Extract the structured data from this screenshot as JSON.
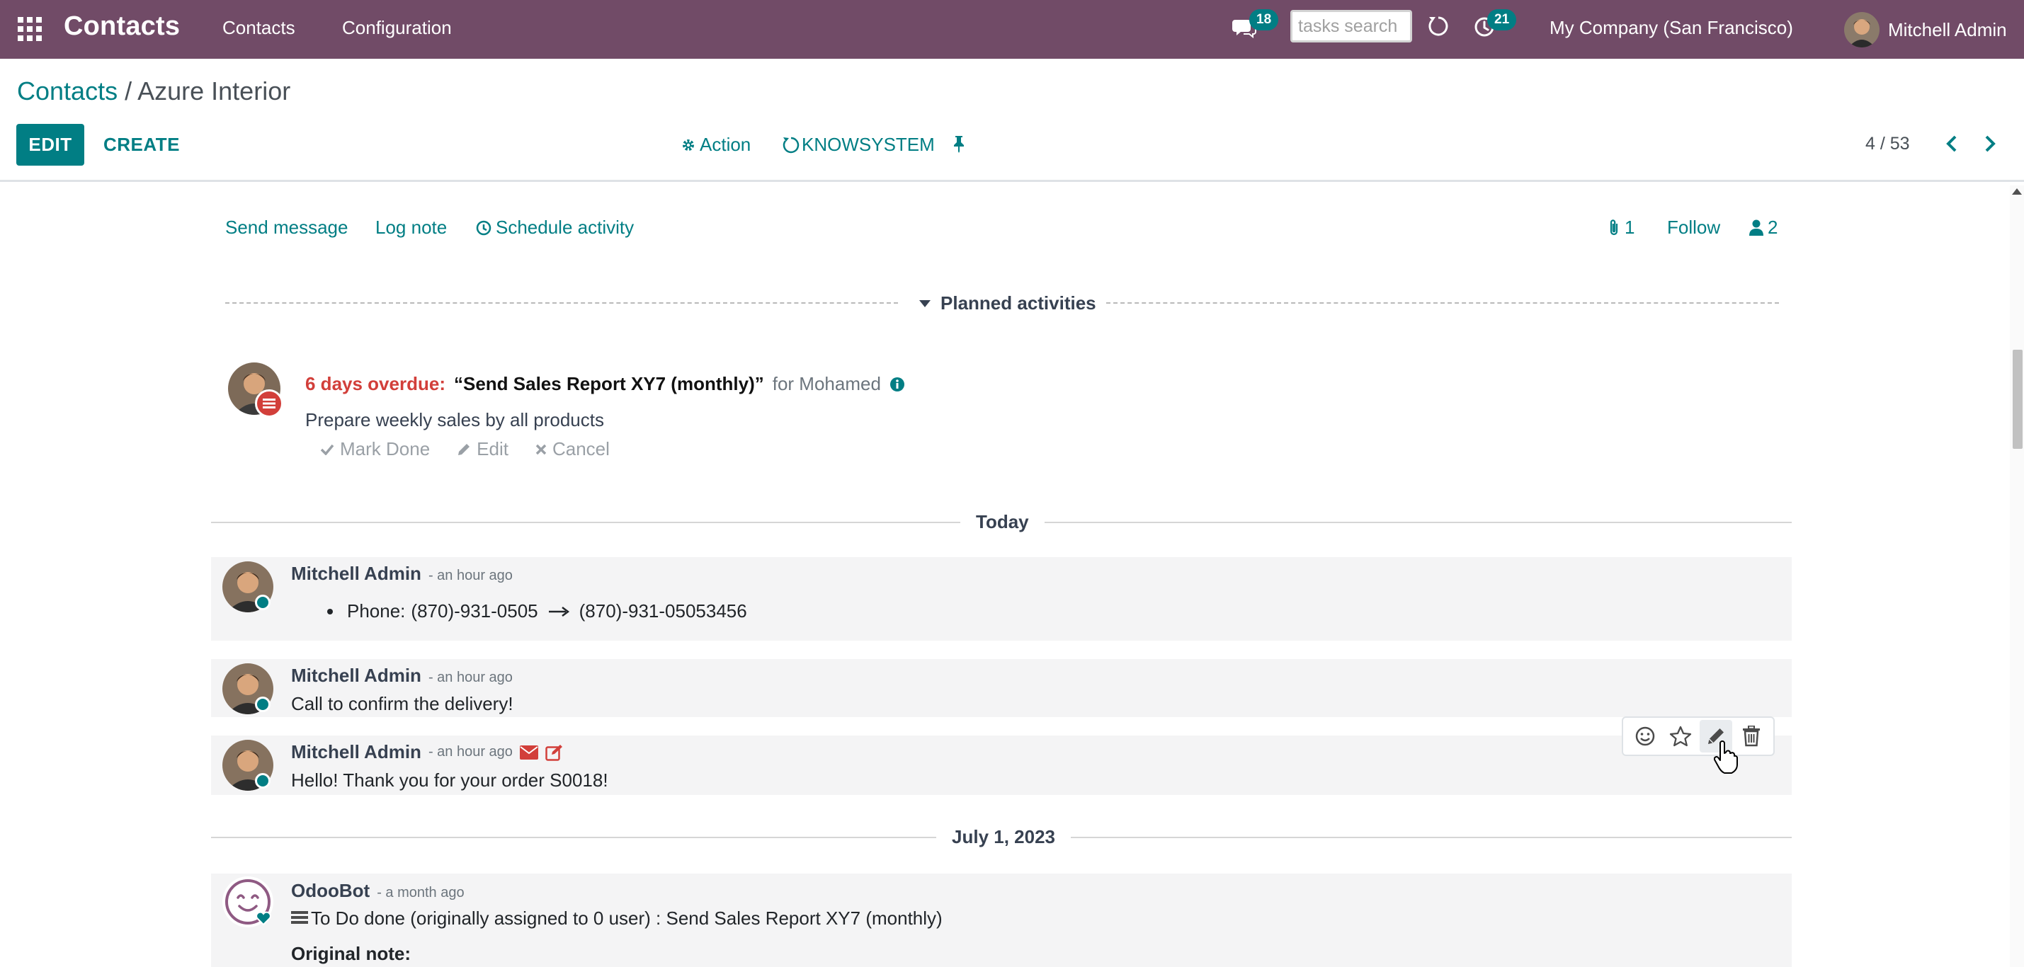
{
  "navbar": {
    "brand": "Contacts",
    "menu": [
      "Contacts",
      "Configuration"
    ],
    "messages_count": "18",
    "search_placeholder": "tasks search",
    "activities_count": "21",
    "company": "My Company (San Francisco)",
    "user_name": "Mitchell Admin",
    "colors": {
      "bar": "#714b67",
      "badge": "#017e84"
    }
  },
  "breadcrumb": {
    "parent": "Contacts",
    "separator": " / ",
    "current": "Azure Interior"
  },
  "control_panel": {
    "edit_label": "EDIT",
    "create_label": "CREATE",
    "action_label": "Action",
    "knowsystem_label": "KNOWSYSTEM",
    "pager": "4 / 53"
  },
  "chatter": {
    "send_message": "Send message",
    "log_note": "Log note",
    "schedule_activity": "Schedule activity",
    "attachments_count": "1",
    "follow": "Follow",
    "followers_count": "2",
    "planned_activities_title": "Planned activities",
    "activity": {
      "overdue": "6 days overdue:",
      "summary": "“Send Sales Report XY7 (monthly)”",
      "for_user": "for Mohamed",
      "note": "Prepare weekly sales by all products",
      "mark_done": "Mark Done",
      "edit": "Edit",
      "cancel": "Cancel"
    },
    "date_today": "Today",
    "date_past": "July 1, 2023",
    "messages": [
      {
        "author": "Mitchell Admin",
        "date": "- an hour ago",
        "tracking_field": "Phone:",
        "old_value": "(870)-931-0505",
        "new_value": "(870)-931-05053456"
      },
      {
        "author": "Mitchell Admin",
        "date": "- an hour ago",
        "body": "Call to confirm the delivery!"
      },
      {
        "author": "Mitchell Admin",
        "date": "- an hour ago",
        "body": "Hello! Thank you for your order S0018!"
      },
      {
        "author": "OdooBot",
        "date": "- a month ago",
        "body": "To Do done (originally assigned to 0 user) : Send Sales Report XY7 (monthly)",
        "subtitle": "Original note:"
      }
    ]
  }
}
